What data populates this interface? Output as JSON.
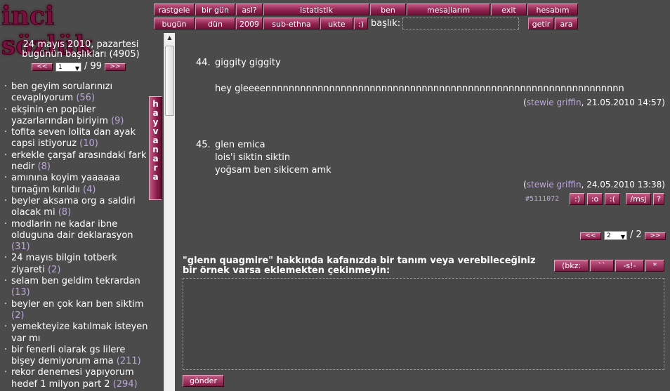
{
  "brand": {
    "logo_text": "inci sözlük"
  },
  "nav_row1": [
    {
      "label": "rastgele"
    },
    {
      "label": "bir gün"
    },
    {
      "label": "asl?"
    },
    {
      "label": "istatistik"
    },
    {
      "label": "ben"
    },
    {
      "label": "mesajlarım"
    },
    {
      "label": "exit"
    },
    {
      "label": "hesabım"
    }
  ],
  "nav_row2": [
    {
      "label": "bugün"
    },
    {
      "label": "dün"
    },
    {
      "label": "2009"
    },
    {
      "label": "sub-ethna"
    },
    {
      "label": "ukte"
    },
    {
      "label": ":)"
    },
    {
      "label": "getir"
    },
    {
      "label": "ara"
    }
  ],
  "search": {
    "label": "başlık:",
    "value": ""
  },
  "left": {
    "date_line": "24 mayıs 2010, pazartesi",
    "today_line": "bugünün başlıkları (4905)",
    "pager": {
      "prev": "<<",
      "page": "1",
      "total": "/ 99",
      "next": ">>"
    },
    "side_tab": "hayvan ara",
    "topics": [
      {
        "title": "ben geyim sorularınızı cevaplıyorum",
        "count": "(56)"
      },
      {
        "title": "ekşinin en popüler yazarlarından biriyim",
        "count": "(9)"
      },
      {
        "title": "tofita seven lolita dan ayak capsi istiyoruz",
        "count": "(10)"
      },
      {
        "title": "erkekle çarşaf arasındaki fark nedir",
        "count": "(8)"
      },
      {
        "title": "amınına koyim yaaaaaa tırnağım kırıldıı",
        "count": "(4)"
      },
      {
        "title": "beyler aksama org a saldiri olacak mi",
        "count": "(8)"
      },
      {
        "title": "modlarin ne kadar ibne olduguna dair deklarasyon",
        "count": "(31)"
      },
      {
        "title": "24 mayıs bilgin totberk ziyareti",
        "count": "(2)"
      },
      {
        "title": "selam ben geldim tekrardan",
        "count": "(13)"
      },
      {
        "title": "beyler en çok karı ben siktim",
        "count": "(2)"
      },
      {
        "title": "yemekteyize katılmak isteyen var mı",
        "count": ""
      },
      {
        "title": "bir fenerli olarak gs lilere bişey demiyorum ama",
        "count": "(211)"
      },
      {
        "title": "rekor denemesi yapıyorum hedef 1 milyon part 2",
        "count": "(294)"
      }
    ]
  },
  "entries": [
    {
      "num": "44.",
      "title": "giggity giggity",
      "body": "hey gleeeennnnnnnnnnnnnnnnnnnnnnnnnnnnnnnnnnnnnnnnnnnnnnnnnnnnnnnnnnnnnn",
      "author": "stewie griffin",
      "date": ", 21.05.2010 14:57)",
      "open": "("
    },
    {
      "num": "45.",
      "lines": [
        "glen emica",
        "lois'i siktin siktin",
        "yoğsam ben sikicem amk"
      ],
      "author": "stewie griffin",
      "date": ", 24.05.2010 13:38)",
      "open": "(",
      "id": "#5111072",
      "actions": [
        ":)",
        ":o",
        ":(",
        "/msj",
        "?"
      ]
    }
  ],
  "bottom_pager": {
    "prev": "<<",
    "page": "2",
    "total": "/ 2",
    "next": ">>"
  },
  "compose": {
    "prompt": "\"glenn quagmire\" hakkında kafanızda bir tanım veya verebileceğiniz bir örnek varsa eklemekten çekinmeyin:",
    "buttons": [
      "(bkz:",
      "``",
      "-s!-",
      "*"
    ],
    "submit": "gönder"
  }
}
